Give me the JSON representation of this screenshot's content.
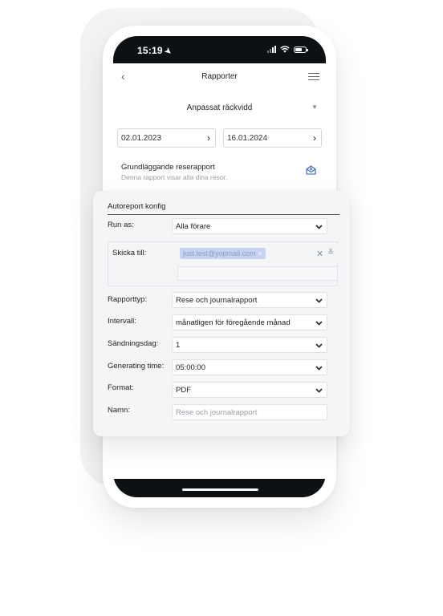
{
  "status_bar": {
    "time": "15:19",
    "location_glyph": "➤"
  },
  "header": {
    "back_glyph": "‹",
    "title": "Rapporter"
  },
  "range": {
    "label": "Anpassat räckvidd",
    "caret": "▼"
  },
  "dates": {
    "start": "02.01.2023",
    "end": "16.01.2024",
    "arrow": "›"
  },
  "report": {
    "title": "Grundläggande reserapport",
    "subtitle": "Denna rapport visar alla dina resor."
  },
  "dialog": {
    "title": "Autoreport konfig",
    "run_as": {
      "label": "Run as:",
      "value": "Alla förare"
    },
    "send_to": {
      "label": "Skicka till:",
      "recipients": [
        "just.test@yopmail.com"
      ],
      "remove_glyph": "×",
      "clear_glyph": "✕",
      "expand_glyph": "≚"
    },
    "report_type": {
      "label": "Rapporttyp:",
      "value": "Rese och journalrapport"
    },
    "interval": {
      "label": "Intervall:",
      "value": "månatligen för föregående månad"
    },
    "send_day": {
      "label": "Sändningsdag:",
      "value": "1"
    },
    "generating_time": {
      "label": "Generating time:",
      "value": "05:00:00"
    },
    "format": {
      "label": "Format:",
      "value": "PDF"
    },
    "name": {
      "label": "Namn:",
      "placeholder": "Rese och journalrapport"
    }
  },
  "colors": {
    "phone_bar": "#0d1114",
    "card_bg": "#f4f5f7",
    "tag_bg": "#c6d3f2",
    "mail_icon": "#2f63c8"
  }
}
